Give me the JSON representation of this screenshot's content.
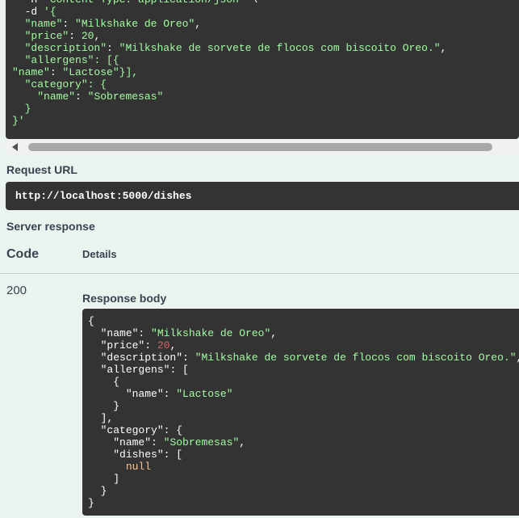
{
  "request": {
    "curl_lines": [
      {
        "indent": "  ",
        "parts": [
          {
            "t": "-H ",
            "c": "plain"
          },
          {
            "t": "'Content-Type: application/json'",
            "c": "str"
          },
          {
            "t": " \\",
            "c": "plain"
          }
        ]
      },
      {
        "indent": "  ",
        "parts": [
          {
            "t": "-d ",
            "c": "plain"
          },
          {
            "t": "'{",
            "c": "str"
          }
        ]
      },
      {
        "indent": "  ",
        "parts": [
          {
            "t": "\"name\"",
            "c": "str"
          },
          {
            "t": ": ",
            "c": "plain"
          },
          {
            "t": "\"Milkshake de Oreo\"",
            "c": "str"
          },
          {
            "t": ",",
            "c": "plain"
          }
        ]
      },
      {
        "indent": "  ",
        "parts": [
          {
            "t": "\"price\"",
            "c": "str"
          },
          {
            "t": ": ",
            "c": "plain"
          },
          {
            "t": "20",
            "c": "str"
          },
          {
            "t": ",",
            "c": "plain"
          }
        ]
      },
      {
        "indent": "  ",
        "parts": [
          {
            "t": "\"description\"",
            "c": "str"
          },
          {
            "t": ": ",
            "c": "plain"
          },
          {
            "t": "\"Milkshake de sorvete de flocos com biscoito Oreo.\"",
            "c": "str"
          },
          {
            "t": ",",
            "c": "plain"
          }
        ]
      },
      {
        "indent": "  ",
        "parts": [
          {
            "t": "\"allergens\"",
            "c": "str"
          },
          {
            "t": ": [{",
            "c": "str"
          }
        ]
      },
      {
        "indent": "",
        "parts": [
          {
            "t": "\"name\"",
            "c": "str"
          },
          {
            "t": ": ",
            "c": "plain"
          },
          {
            "t": "\"Lactose\"",
            "c": "str"
          },
          {
            "t": "}],",
            "c": "str"
          }
        ]
      },
      {
        "indent": "  ",
        "parts": [
          {
            "t": "\"category\"",
            "c": "str"
          },
          {
            "t": ": {",
            "c": "str"
          }
        ]
      },
      {
        "indent": "    ",
        "parts": [
          {
            "t": "\"name\"",
            "c": "str"
          },
          {
            "t": ": ",
            "c": "plain"
          },
          {
            "t": "\"Sobremesas\"",
            "c": "str"
          }
        ]
      },
      {
        "indent": "  ",
        "parts": [
          {
            "t": "}",
            "c": "str"
          }
        ]
      },
      {
        "indent": "",
        "parts": [
          {
            "t": "}'",
            "c": "str"
          }
        ]
      }
    ],
    "url_label": "Request URL",
    "url": "http://localhost:5000/dishes"
  },
  "response": {
    "section_label": "Server response",
    "col_code": "Code",
    "col_details": "Details",
    "status_code": "200",
    "body_label": "Response body",
    "body_lines": [
      {
        "indent": "",
        "parts": [
          {
            "t": "{",
            "c": "key"
          }
        ]
      },
      {
        "indent": "  ",
        "parts": [
          {
            "t": "\"name\"",
            "c": "key"
          },
          {
            "t": ": ",
            "c": "key"
          },
          {
            "t": "\"Milkshake de Oreo\"",
            "c": "str"
          },
          {
            "t": ",",
            "c": "key"
          }
        ]
      },
      {
        "indent": "  ",
        "parts": [
          {
            "t": "\"price\"",
            "c": "key"
          },
          {
            "t": ": ",
            "c": "key"
          },
          {
            "t": "20",
            "c": "num"
          },
          {
            "t": ",",
            "c": "key"
          }
        ]
      },
      {
        "indent": "  ",
        "parts": [
          {
            "t": "\"description\"",
            "c": "key"
          },
          {
            "t": ": ",
            "c": "key"
          },
          {
            "t": "\"Milkshake de sorvete de flocos com biscoito Oreo.\"",
            "c": "str"
          },
          {
            "t": ",",
            "c": "key"
          }
        ]
      },
      {
        "indent": "  ",
        "parts": [
          {
            "t": "\"allergens\"",
            "c": "key"
          },
          {
            "t": ": [",
            "c": "key"
          }
        ]
      },
      {
        "indent": "    ",
        "parts": [
          {
            "t": "{",
            "c": "key"
          }
        ]
      },
      {
        "indent": "      ",
        "parts": [
          {
            "t": "\"name\"",
            "c": "key"
          },
          {
            "t": ": ",
            "c": "key"
          },
          {
            "t": "\"Lactose\"",
            "c": "str"
          }
        ]
      },
      {
        "indent": "    ",
        "parts": [
          {
            "t": "}",
            "c": "key"
          }
        ]
      },
      {
        "indent": "  ",
        "parts": [
          {
            "t": "],",
            "c": "key"
          }
        ]
      },
      {
        "indent": "  ",
        "parts": [
          {
            "t": "\"category\"",
            "c": "key"
          },
          {
            "t": ": {",
            "c": "key"
          }
        ]
      },
      {
        "indent": "    ",
        "parts": [
          {
            "t": "\"name\"",
            "c": "key"
          },
          {
            "t": ": ",
            "c": "key"
          },
          {
            "t": "\"Sobremesas\"",
            "c": "str"
          },
          {
            "t": ",",
            "c": "key"
          }
        ]
      },
      {
        "indent": "    ",
        "parts": [
          {
            "t": "\"dishes\"",
            "c": "key"
          },
          {
            "t": ": [",
            "c": "key"
          }
        ]
      },
      {
        "indent": "      ",
        "parts": [
          {
            "t": "null",
            "c": "null"
          }
        ]
      },
      {
        "indent": "    ",
        "parts": [
          {
            "t": "]",
            "c": "key"
          }
        ]
      },
      {
        "indent": "  ",
        "parts": [
          {
            "t": "}",
            "c": "key"
          }
        ]
      },
      {
        "indent": "",
        "parts": [
          {
            "t": "}",
            "c": "key"
          }
        ]
      }
    ]
  },
  "colors": {
    "page_bg": "#ebf3ee",
    "code_bg": "#333333",
    "string": "#a2fca2",
    "number": "#d36363",
    "null": "#fcc28c",
    "label": "#3b4151"
  },
  "icons": {
    "scroll_left": "scroll-left-arrow-icon"
  }
}
